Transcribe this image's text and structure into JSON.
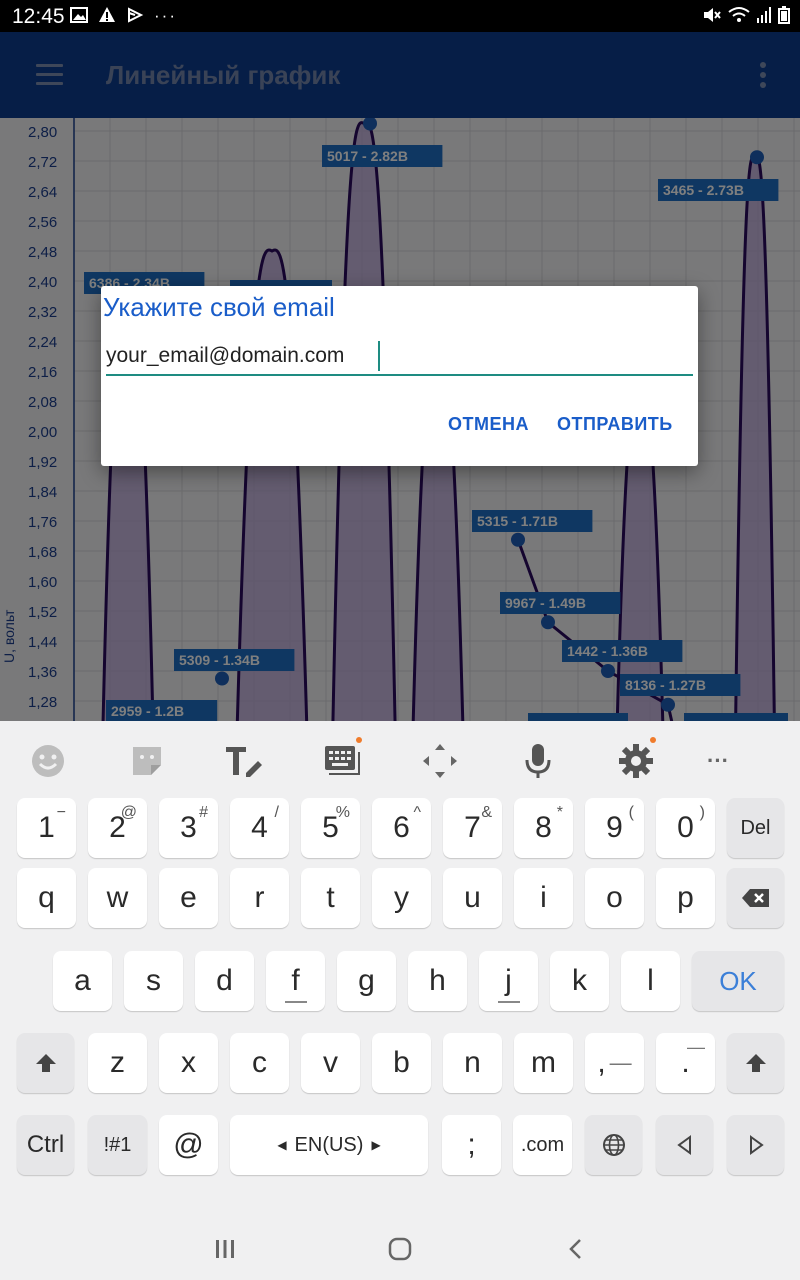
{
  "status_bar": {
    "time": "12:45",
    "left_icons": [
      "image-icon",
      "warning-icon",
      "cast-icon",
      "more-dots-icon"
    ],
    "right_icons": [
      "mute-icon",
      "wifi-icon",
      "signal-icon",
      "battery-icon"
    ]
  },
  "app_bar": {
    "title": "Линейный график",
    "color": "#0d3c8f"
  },
  "chart_data": {
    "type": "line",
    "ylabel": "U, вольт",
    "y_ticks": [
      "2,80",
      "2,72",
      "2,64",
      "2,56",
      "2,48",
      "2,40",
      "2,32",
      "2,24",
      "2,16",
      "2,08",
      "2,00",
      "1,92",
      "1,84",
      "1,76",
      "1,68",
      "1,60",
      "1,52",
      "1,44",
      "1,36",
      "1,28"
    ],
    "point_labels": [
      "6386 - 2.34В",
      "5017 - 2.82В",
      "3465 - 2.73В",
      "5315 - 1.71В",
      "9967 - 1.49В",
      "1442 - 1.36В",
      "8136 - 1.27В",
      "5309 - 1.34В",
      "2959 - 1.2В"
    ],
    "points": [
      {
        "y": 1.34
      },
      {
        "y": 2.82
      },
      {
        "y": 2.73
      },
      {
        "y": 1.71
      },
      {
        "y": 1.49
      },
      {
        "y": 1.36
      },
      {
        "y": 1.27
      }
    ],
    "line_color": "#2a0a5e",
    "fill_color": "#b9a6d8",
    "label_bg": "#1e6fc4"
  },
  "dialog": {
    "title": "Укажите свой email",
    "input_value": "your_email@domain.com",
    "cancel_label": "ОТМЕНА",
    "send_label": "ОТПРАВИТЬ"
  },
  "keyboard": {
    "toolbar": [
      "emoji-icon",
      "sticker-icon",
      "handwriting-icon",
      "keyboard-layout-icon",
      "move-icon",
      "mic-icon",
      "settings-icon",
      "more-icon"
    ],
    "number_row": [
      {
        "k": "1",
        "s": "−"
      },
      {
        "k": "2",
        "s": "@"
      },
      {
        "k": "3",
        "s": "#"
      },
      {
        "k": "4",
        "s": "/"
      },
      {
        "k": "5",
        "s": "%"
      },
      {
        "k": "6",
        "s": "^"
      },
      {
        "k": "7",
        "s": "&"
      },
      {
        "k": "8",
        "s": "*"
      },
      {
        "k": "9",
        "s": "("
      },
      {
        "k": "0",
        "s": ")"
      }
    ],
    "del_label": "Del",
    "row1": [
      "q",
      "w",
      "e",
      "r",
      "t",
      "y",
      "u",
      "i",
      "o",
      "p"
    ],
    "row2": [
      "a",
      "s",
      "d",
      "f",
      "g",
      "h",
      "j",
      "k",
      "l"
    ],
    "ok_label": "OK",
    "row3": [
      "z",
      "x",
      "c",
      "v",
      "b",
      "n",
      "m"
    ],
    "comma_key": ",",
    "period_key": ".",
    "ctrl_label": "Ctrl",
    "sym_label": "!#1",
    "at_label": "@",
    "space_label": "EN(US)",
    "semicolon_label": ";",
    "dotcom_label": ".com"
  }
}
